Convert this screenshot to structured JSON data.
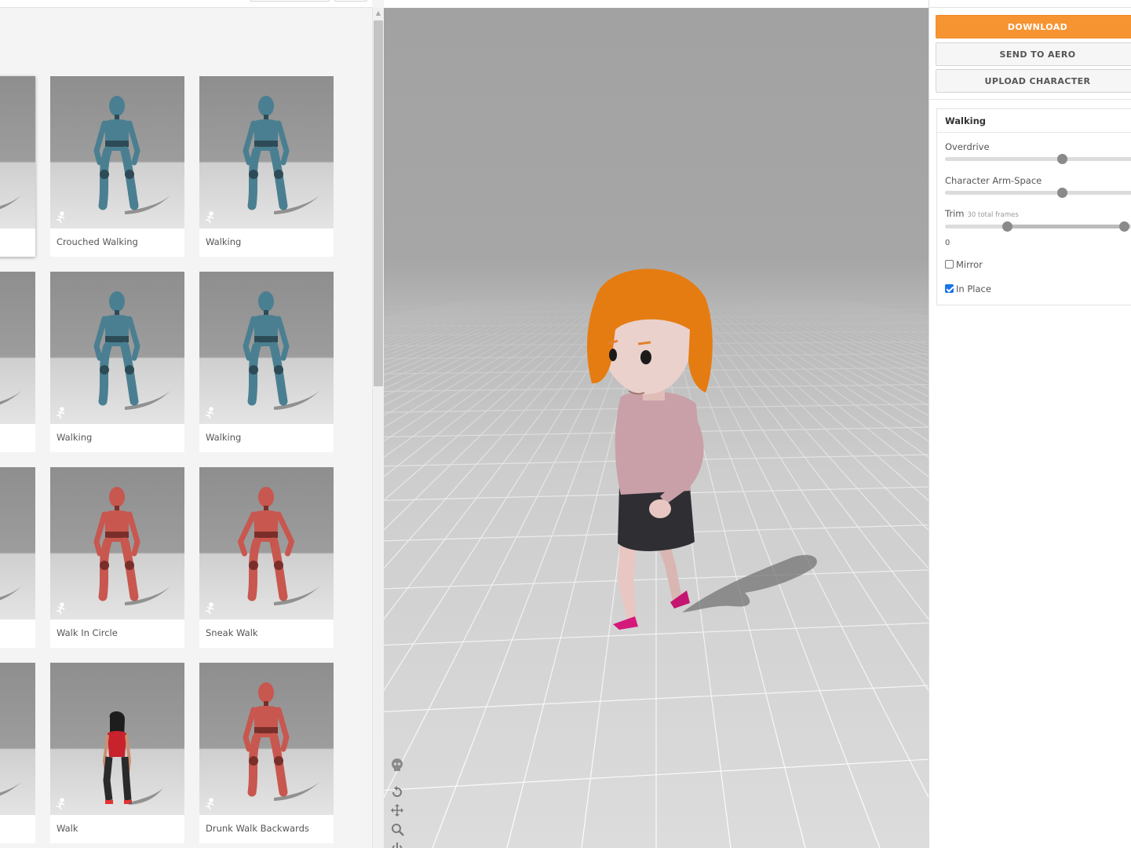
{
  "library": {
    "cards": [
      {
        "label": "",
        "figure": "blue",
        "selected": true
      },
      {
        "label": "Crouched Walking",
        "figure": "blue"
      },
      {
        "label": "Walking",
        "figure": "blue"
      },
      {
        "label": "",
        "figure": "blue"
      },
      {
        "label": "Walking",
        "figure": "blue"
      },
      {
        "label": "Walking",
        "figure": "blue"
      },
      {
        "label": "",
        "figure": "red"
      },
      {
        "label": "Walk In Circle",
        "figure": "red"
      },
      {
        "label": "Sneak Walk",
        "figure": "red"
      },
      {
        "label": "",
        "figure": "red"
      },
      {
        "label": "Walk",
        "figure": "woman"
      },
      {
        "label": "Drunk Walk Backwards",
        "figure": "red"
      }
    ],
    "card_icon": "running-figure-icon"
  },
  "viewport": {
    "character": "cartoon woman with orange hair, pink shirt, black skirt, pink heels",
    "tools": [
      "skull-icon",
      "rotate-icon",
      "move-icon",
      "zoom-icon",
      "power-icon"
    ]
  },
  "panel": {
    "download_label": "DOWNLOAD",
    "send_label": "SEND TO AERO",
    "upload_label": "UPLOAD CHARACTER",
    "animation_title": "Walking",
    "overdrive_label": "Overdrive",
    "overdrive_value": 0.6,
    "arm_space_label": "Character Arm-Space",
    "arm_space_value": 0.6,
    "trim_label": "Trim",
    "trim_note": "30 total frames",
    "trim_start": 0.32,
    "trim_end": 0.92,
    "trim_start_value": "0",
    "mirror_label": "Mirror",
    "mirror_checked": false,
    "in_place_label": "In Place",
    "in_place_checked": true
  },
  "colors": {
    "accent": "#f79432",
    "blue_figure": "#4a7f91",
    "red_figure": "#c8574f",
    "hair": "#e57c12",
    "shirt": "#c9a0a8",
    "skirt": "#2f2f33",
    "heels": "#d4197a"
  }
}
